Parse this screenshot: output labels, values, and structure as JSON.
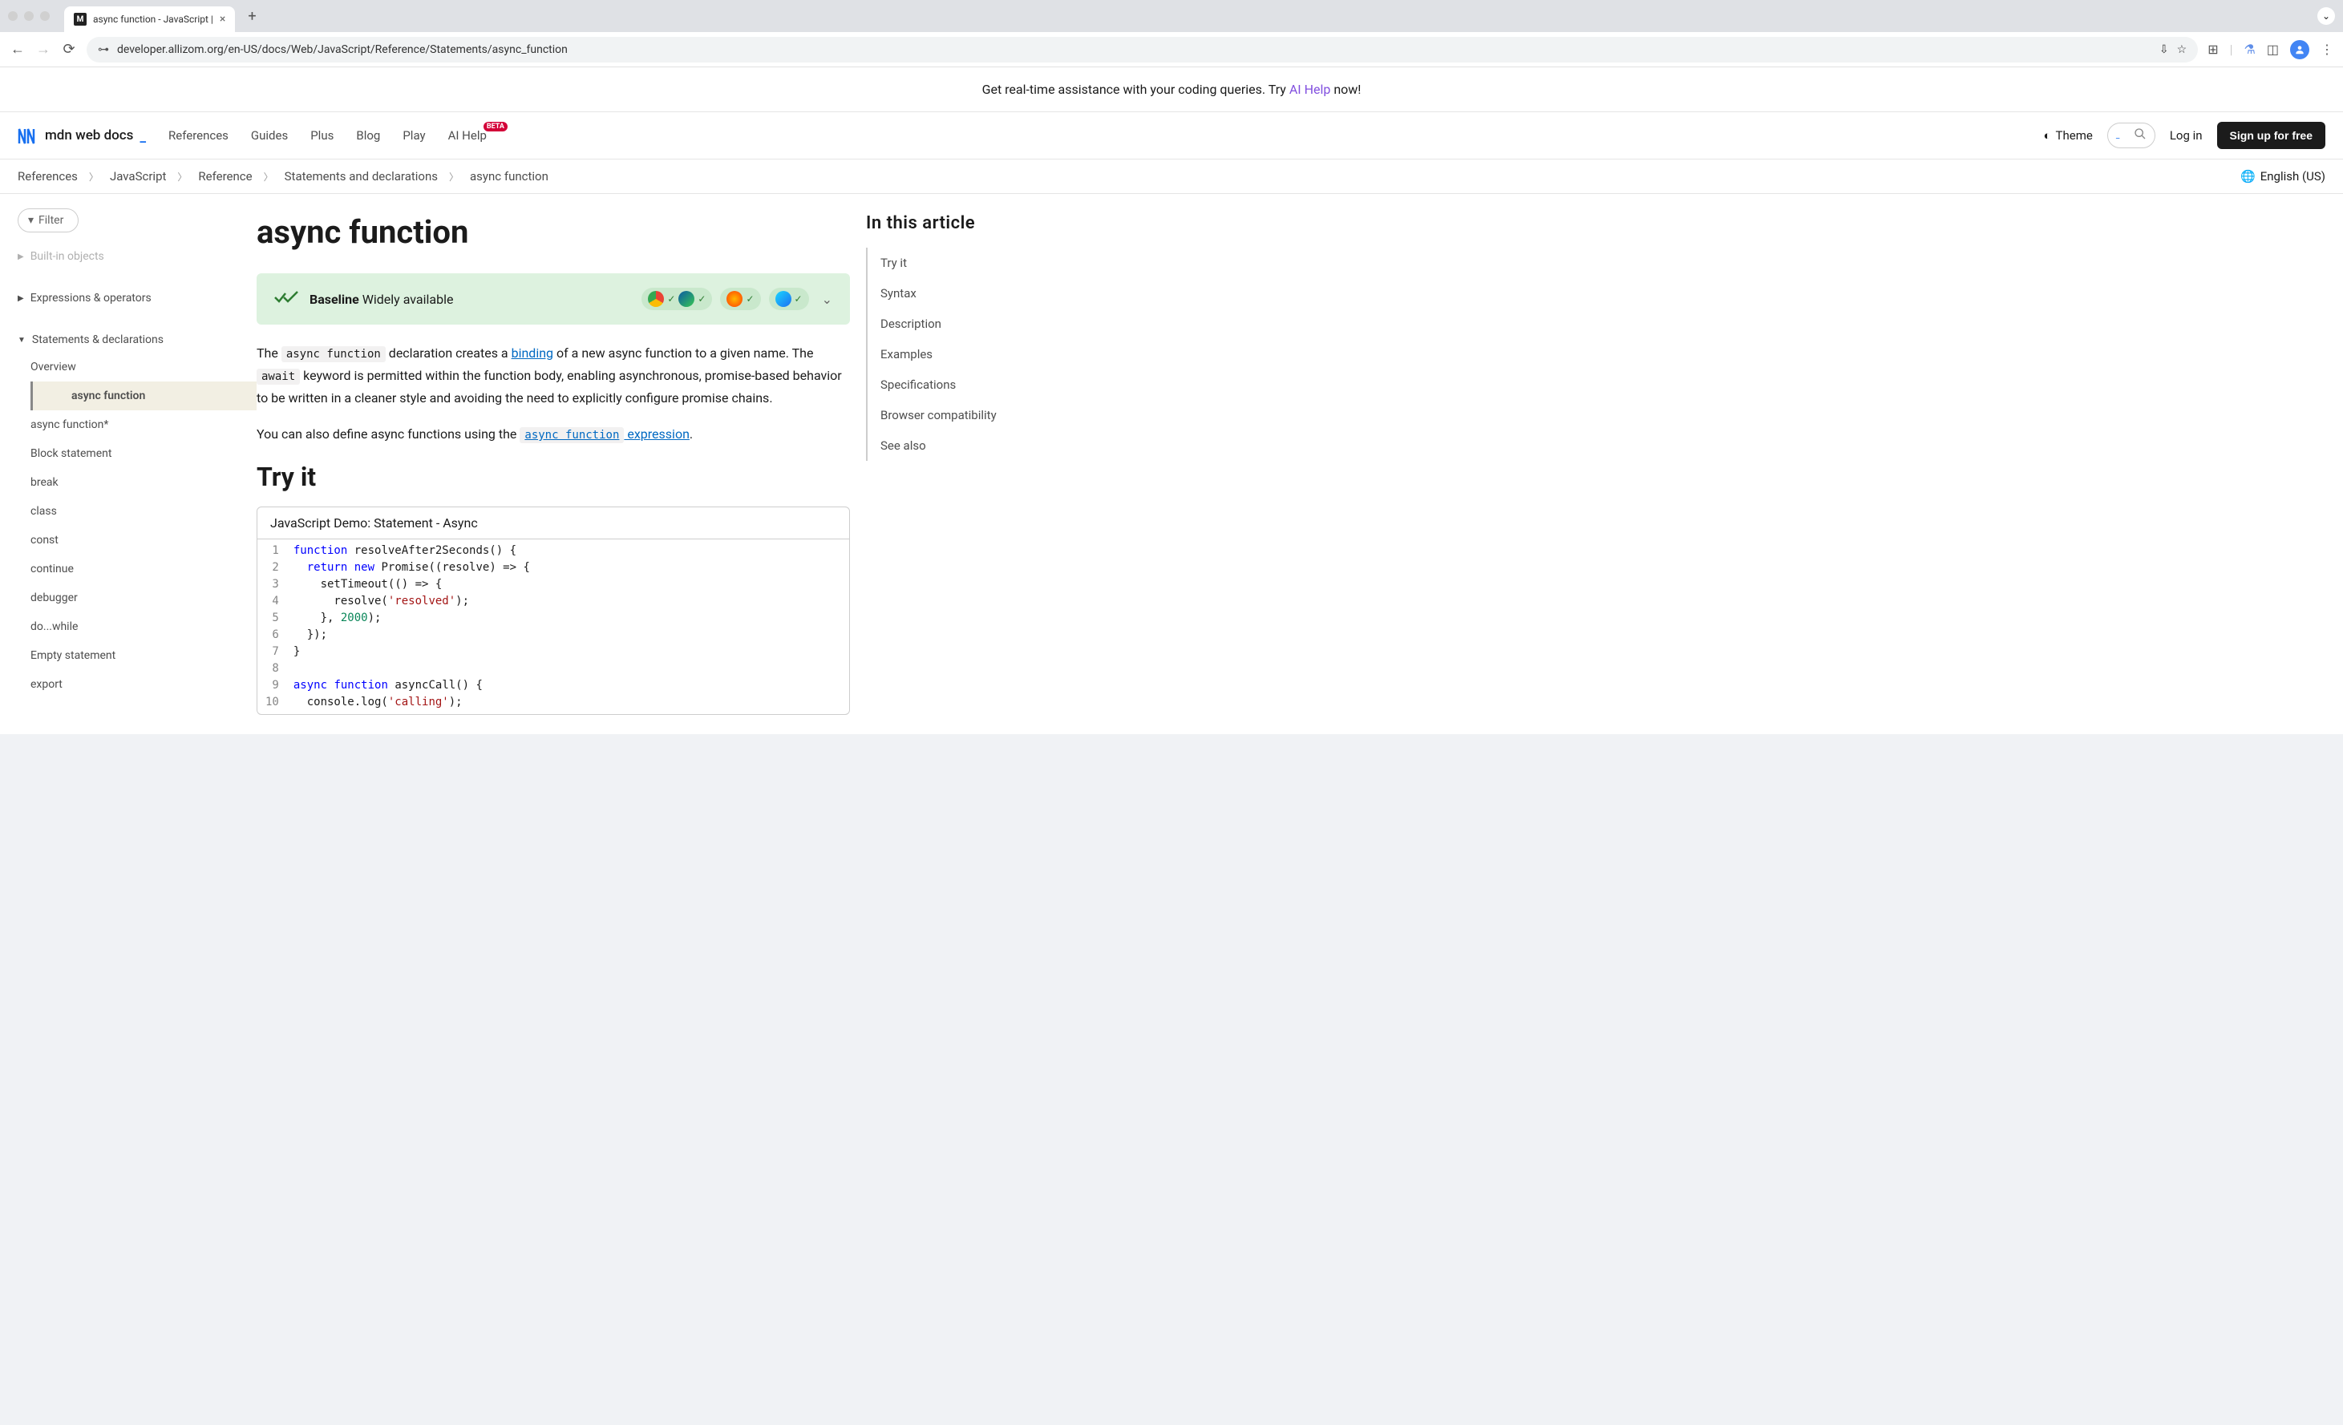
{
  "browser": {
    "tab_title": "async function - JavaScript |",
    "url": "developer.allizom.org/en-US/docs/Web/JavaScript/Reference/Statements/async_function"
  },
  "promo": {
    "prefix": "Get real-time assistance with your coding queries. Try ",
    "link": "AI Help",
    "suffix": " now!"
  },
  "header": {
    "logo_text": "mdn web docs",
    "nav": [
      "References",
      "Guides",
      "Plus",
      "Blog",
      "Play",
      "AI Help"
    ],
    "beta": "BETA",
    "theme_label": "Theme",
    "login": "Log in",
    "signup": "Sign up for free"
  },
  "breadcrumb": [
    "References",
    "JavaScript",
    "Reference",
    "Statements and declarations",
    "async function"
  ],
  "lang": "English (US)",
  "sidebar": {
    "filter_label": "Filter",
    "faded": "Built-in objects",
    "sections": [
      {
        "label": "Expressions & operators",
        "expanded": false
      },
      {
        "label": "Statements & declarations",
        "expanded": true
      }
    ],
    "items": [
      "Overview",
      "async function",
      "async function*",
      "Block statement",
      "break",
      "class",
      "const",
      "continue",
      "debugger",
      "do...while",
      "Empty statement",
      "export"
    ]
  },
  "article": {
    "title": "async function",
    "baseline_strong": "Baseline",
    "baseline_rest": " Widely available",
    "p1_pre": "The ",
    "p1_code1": "async function",
    "p1_mid1": " declaration creates a ",
    "p1_link": "binding",
    "p1_mid2": " of a new async function to a given name. The ",
    "p1_code2": "await",
    "p1_after": " keyword is permitted within the function body, enabling asynchronous, promise-based behavior to be written in a cleaner style and avoiding the need to explicitly configure promise chains.",
    "p2_pre": "You can also define async functions using the ",
    "p2_linkcode": "async function",
    "p2_linktext": " expression",
    "p2_after": ".",
    "tryit": "Try it",
    "demo_header": "JavaScript Demo: Statement - Async",
    "code_lines": [
      {
        "n": 1,
        "html": "<span class='tok-kw'>function</span> resolveAfter2Seconds() {"
      },
      {
        "n": 2,
        "html": "  <span class='tok-kw'>return</span> <span class='tok-kw'>new</span> Promise((resolve) =&gt; {"
      },
      {
        "n": 3,
        "html": "    setTimeout(() =&gt; {"
      },
      {
        "n": 4,
        "html": "      resolve(<span class='tok-str'>'resolved'</span>);"
      },
      {
        "n": 5,
        "html": "    }, <span class='tok-num'>2000</span>);"
      },
      {
        "n": 6,
        "html": "  });"
      },
      {
        "n": 7,
        "html": "}"
      },
      {
        "n": 8,
        "html": ""
      },
      {
        "n": 9,
        "html": "<span class='tok-kw'>async</span> <span class='tok-kw'>function</span> asyncCall() {"
      },
      {
        "n": 10,
        "html": "  console.log(<span class='tok-str'>'calling'</span>);"
      }
    ]
  },
  "toc": {
    "title": "In this article",
    "items": [
      "Try it",
      "Syntax",
      "Description",
      "Examples",
      "Specifications",
      "Browser compatibility",
      "See also"
    ]
  }
}
